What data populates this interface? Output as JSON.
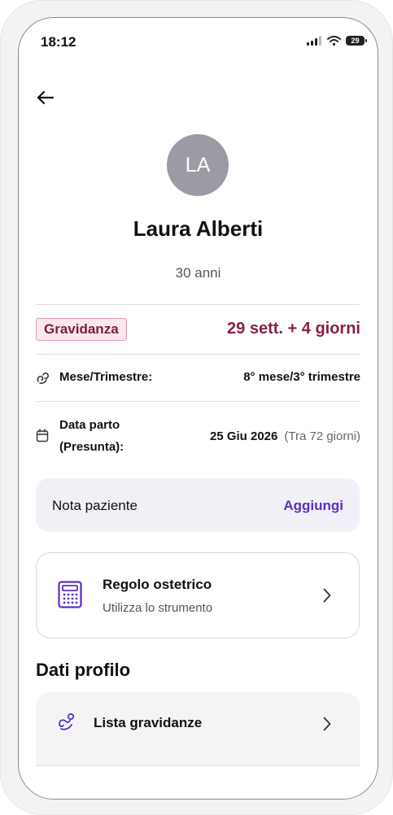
{
  "status": {
    "time": "18:12",
    "battery": "29"
  },
  "patient": {
    "initials": "LA",
    "name": "Laura Alberti",
    "age": "30 anni"
  },
  "pregnancy": {
    "badge": "Gravidanza",
    "gestation": "29 sett. + 4 giorni",
    "month_label": "Mese/Trimestre:",
    "month_value": "8° mese/3° trimestre",
    "due_label_1": "Data parto",
    "due_label_2": "(Presunta):",
    "due_date": "25 Giu 2026",
    "due_remaining": "(Tra 72 giorni)"
  },
  "note": {
    "label": "Nota paziente",
    "action": "Aggiungi"
  },
  "tool": {
    "title": "Regolo ostetrico",
    "subtitle": "Utilizza lo strumento"
  },
  "profile": {
    "title": "Dati profilo",
    "items": [
      {
        "label": "Lista gravidanze"
      }
    ]
  },
  "colors": {
    "accent": "#5b2ec4",
    "pregnancy": "#8a1f47",
    "badge_bg": "#fbe7ee",
    "avatar": "#9c9ba4"
  }
}
